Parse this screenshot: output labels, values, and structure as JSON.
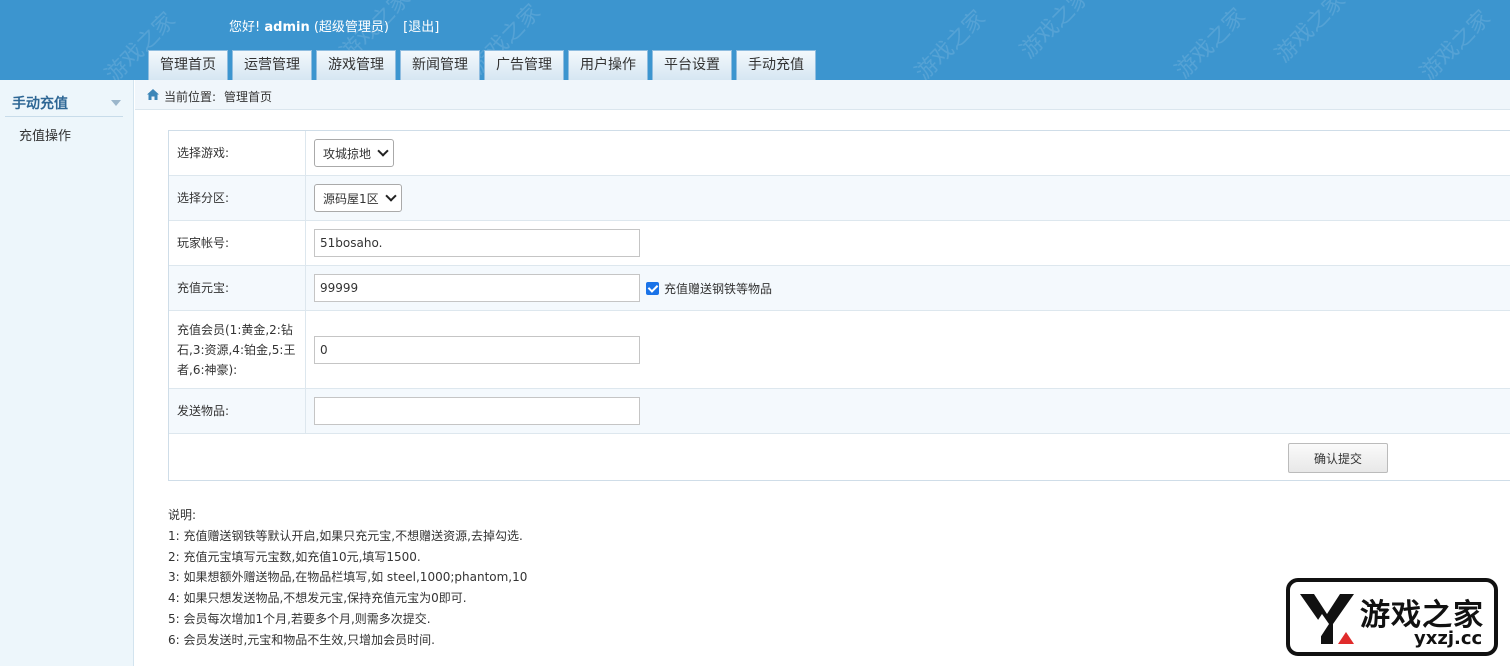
{
  "header": {
    "greeting": "您好!",
    "user": "admin",
    "role": "(超级管理员)",
    "logout": "[退出]",
    "watermark": "游戏之家",
    "tabs": [
      "管理首页",
      "运营管理",
      "游戏管理",
      "新闻管理",
      "广告管理",
      "用户操作",
      "平台设置",
      "手动充值"
    ]
  },
  "sidebar": {
    "title": "手动充值",
    "items": [
      "充值操作"
    ]
  },
  "breadcrumb": {
    "label": "当前位置:",
    "current": "管理首页"
  },
  "form": {
    "game": {
      "label": "选择游戏:",
      "selected": "攻城掠地"
    },
    "server": {
      "label": "选择分区:",
      "selected": "源码屋1区"
    },
    "account": {
      "label": "玩家帐号:",
      "value": "51bosaho."
    },
    "ingot": {
      "label": "充值元宝:",
      "value": "99999",
      "checkbox_label": "充值赠送钢铁等物品",
      "checked": true
    },
    "vip": {
      "label": "充值会员(1:黄金,2:钻石,3:资源,4:铂金,5:王者,6:神豪):",
      "value": "0"
    },
    "items": {
      "label": "发送物品:",
      "value": ""
    },
    "submit": "确认提交"
  },
  "notes": {
    "title": "说明:",
    "lines": [
      "1: 充值赠送钢铁等默认开启,如果只充元宝,不想赠送资源,去掉勾选.",
      "2: 充值元宝填写元宝数,如充值10元,填写1500.",
      "3: 如果想额外赠送物品,在物品栏填写,如 steel,1000;phantom,10",
      "4: 如果只想发送物品,不想发元宝,保持充值元宝为0即可.",
      "5: 会员每次增加1个月,若要多个月,则需多次提交.",
      "6: 会员发送时,元宝和物品不生效,只增加会员时间."
    ]
  },
  "logo": {
    "text_cn": "游戏之家",
    "text_en": "yxzj.cc"
  }
}
